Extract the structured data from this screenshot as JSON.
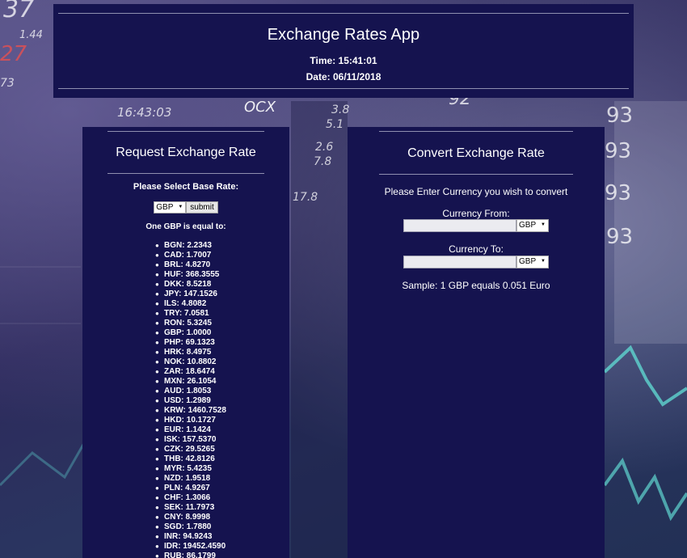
{
  "header": {
    "title": "Exchange Rates App",
    "time": "Time: 15:41:01",
    "date": "Date: 06/11/2018"
  },
  "request_panel": {
    "title": "Request Exchange Rate",
    "select_label": "Please Select Base Rate:",
    "base_value": "GBP",
    "submit_label": "submit",
    "equal_label": "One GBP is equal to:",
    "rates": [
      "BGN: 2.2343",
      "CAD: 1.7007",
      "BRL: 4.8270",
      "HUF: 368.3555",
      "DKK: 8.5218",
      "JPY: 147.1526",
      "ILS: 4.8082",
      "TRY: 7.0581",
      "RON: 5.3245",
      "GBP: 1.0000",
      "PHP: 69.1323",
      "HRK: 8.4975",
      "NOK: 10.8802",
      "ZAR: 18.6474",
      "MXN: 26.1054",
      "AUD: 1.8053",
      "USD: 1.2989",
      "KRW: 1460.7528",
      "HKD: 10.1727",
      "EUR: 1.1424",
      "ISK: 157.5370",
      "CZK: 29.5265",
      "THB: 42.8126",
      "MYR: 5.4235",
      "NZD: 1.9518",
      "PLN: 4.9267",
      "CHF: 1.3066",
      "SEK: 11.7973",
      "CNY: 8.9998",
      "SGD: 1.7880",
      "INR: 94.9243",
      "IDR: 19452.4590",
      "RUB: 86.1799"
    ]
  },
  "convert_panel": {
    "title": "Convert Exchange Rate",
    "prompt": "Please Enter Currency you wish to convert",
    "from_label": "Currency From:",
    "from_value": "",
    "from_currency": "GBP",
    "to_label": "Currency To:",
    "to_value": "",
    "to_currency": "GBP",
    "sample": "Sample: 1 GBP equals 0.051 Euro"
  },
  "background_text": [
    "37",
    "27",
    "1.44",
    "73",
    "16:43:03",
    "OCX",
    "3.8",
    "5.1",
    "2.6",
    "7.8",
    "92",
    "93",
    "93",
    "93",
    "93",
    "17.8"
  ],
  "colors": {
    "panel_bg": "#15134f",
    "rule": "#8f8fb0",
    "accent_chart": "#5fd6d0"
  }
}
